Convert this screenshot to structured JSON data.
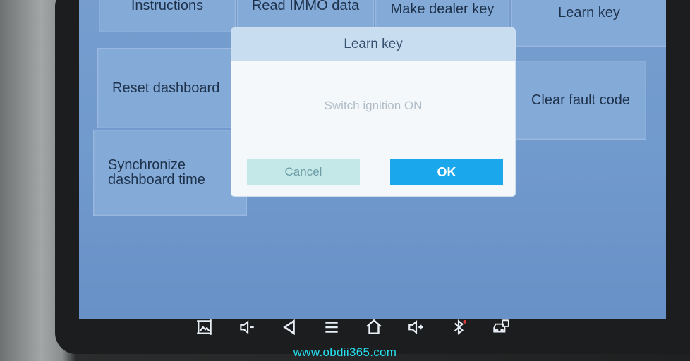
{
  "menu": {
    "instructions": "Instructions",
    "read_immo_data": "Read IMMO data",
    "make_dealer_key": "Make dealer key",
    "learn_key": "Learn key",
    "reset_dashboard": "Reset dashboard",
    "clear_fault_code": "Clear fault code",
    "synchronize_line1": "Synchronize",
    "synchronize_line2": "dashboard time"
  },
  "dialog": {
    "title": "Learn key",
    "message": "Switch ignition ON",
    "cancel_label": "Cancel",
    "ok_label": "OK"
  },
  "navbar": {
    "icons": [
      "screenshot-icon",
      "volume-down-icon",
      "back-icon",
      "menu-icon",
      "home-icon",
      "volume-up-icon",
      "bluetooth-icon",
      "vci-icon"
    ]
  },
  "watermark": "www.obdii365.com",
  "colors": {
    "screen_bg": "#7fa8da",
    "tile_bg": "#8fb6e4",
    "ok_button": "#1aa7ec",
    "cancel_button": "#c4e7e8",
    "watermark": "#26e1f0"
  }
}
